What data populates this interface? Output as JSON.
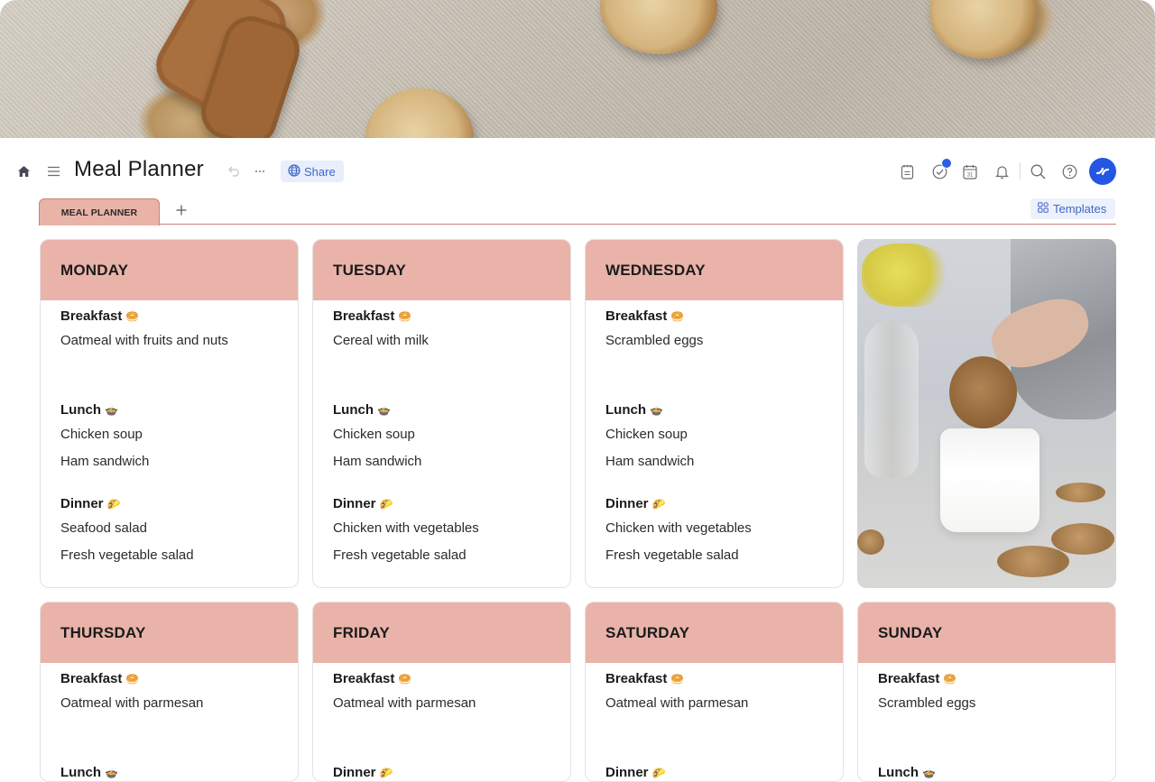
{
  "header": {
    "title": "Meal Planner",
    "share_label": "Share",
    "templates_label": "Templates"
  },
  "icons": {
    "home": "home-icon",
    "menu": "hamburger-menu-icon",
    "undo": "undo-icon",
    "more": "more-options-icon",
    "share": "globe-icon",
    "notes": "notepad-icon",
    "tasks": "check-circle-icon",
    "calendar": "calendar-icon",
    "notifications": "bell-icon",
    "search": "search-icon",
    "help": "help-icon",
    "templates": "grid-icon"
  },
  "calendar_icon_day": "31",
  "tabs": [
    {
      "label": "MEAL PLANNER",
      "active": true
    }
  ],
  "colors": {
    "accent": "#2456e4",
    "card_header": "#e9b3a9",
    "tab_border": "#c98378"
  },
  "meal_emojis": {
    "Breakfast": "🥯",
    "Lunch": "🍲",
    "Dinner": "🌮"
  },
  "days": [
    {
      "name": "MONDAY",
      "meals": [
        {
          "label": "Breakfast",
          "emoji": "🥯",
          "items": [
            "Oatmeal with fruits and nuts"
          ]
        },
        {
          "label": "Lunch",
          "emoji": "🍲",
          "items": [
            "Chicken soup",
            "Ham sandwich"
          ]
        },
        {
          "label": "Dinner",
          "emoji": "🌮",
          "items": [
            "Seafood salad",
            "Fresh vegetable salad"
          ]
        }
      ]
    },
    {
      "name": "TUESDAY",
      "meals": [
        {
          "label": "Breakfast",
          "emoji": "🥯",
          "items": [
            "Cereal with milk"
          ]
        },
        {
          "label": "Lunch",
          "emoji": "🍲",
          "items": [
            "Chicken soup",
            "Ham sandwich"
          ]
        },
        {
          "label": "Dinner",
          "emoji": "🌮",
          "items": [
            "Chicken with vegetables",
            "Fresh vegetable salad"
          ]
        }
      ]
    },
    {
      "name": "WEDNESDAY",
      "meals": [
        {
          "label": "Breakfast",
          "emoji": "🥯",
          "items": [
            "Scrambled eggs"
          ]
        },
        {
          "label": "Lunch",
          "emoji": "🍲",
          "items": [
            "Chicken soup",
            "Ham sandwich"
          ]
        },
        {
          "label": "Dinner",
          "emoji": "🌮",
          "items": [
            "Chicken with vegetables",
            "Fresh vegetable salad"
          ]
        }
      ]
    },
    {
      "name": "THURSDAY",
      "meals": [
        {
          "label": "Breakfast",
          "emoji": "🥯",
          "items": [
            "Oatmeal with parmesan"
          ]
        },
        {
          "label": "Lunch",
          "emoji": "🍲",
          "items": []
        }
      ]
    },
    {
      "name": "FRIDAY",
      "meals": [
        {
          "label": "Breakfast",
          "emoji": "🥯",
          "items": [
            "Oatmeal with parmesan"
          ]
        },
        {
          "label": "Dinner",
          "emoji": "🌮",
          "items": []
        }
      ]
    },
    {
      "name": "SATURDAY",
      "meals": [
        {
          "label": "Breakfast",
          "emoji": "🥯",
          "items": [
            "Oatmeal with parmesan"
          ]
        },
        {
          "label": "Dinner",
          "emoji": "🌮",
          "items": []
        }
      ]
    },
    {
      "name": "SUNDAY",
      "meals": [
        {
          "label": "Breakfast",
          "emoji": "🥯",
          "items": [
            "Scrambled eggs"
          ]
        },
        {
          "label": "Lunch",
          "emoji": "🍲",
          "items": []
        }
      ]
    }
  ],
  "images": {
    "banner": "cookies-on-linen-photo",
    "card_photo": "cookie-dipped-in-milk-photo"
  }
}
